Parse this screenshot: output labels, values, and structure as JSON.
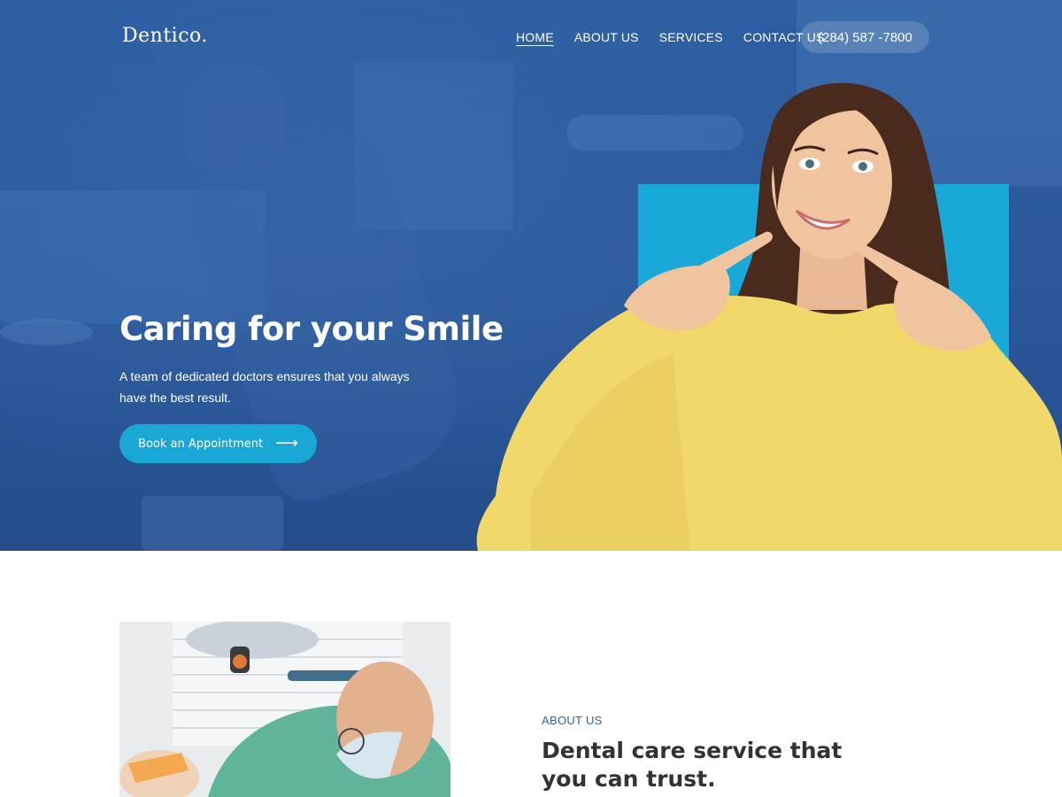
{
  "brand": {
    "logo": "Dentico."
  },
  "nav": {
    "items": [
      {
        "label": "HOME"
      },
      {
        "label": "ABOUT US"
      },
      {
        "label": "SERVICES"
      },
      {
        "label": "CONTACT US"
      }
    ],
    "active": "HOME",
    "phone": "(284) 587 -7800"
  },
  "hero": {
    "title": "Caring for your Smile",
    "subtitle": "A team of dedicated doctors ensures that you always have the best result.",
    "cta_label": "Book an Appointment",
    "cta_icon": "arrow-right-icon"
  },
  "about": {
    "label": "ABOUT US",
    "heading": "Dental care service that you can trust."
  },
  "colors": {
    "hero_blue": "#2a5a9e",
    "accent_cyan": "#19a8d6",
    "about_label": "#2a63a8",
    "heading_text": "#333333",
    "sweater_yellow": "#f0d86a",
    "hair_brown": "#4a2a1c"
  }
}
